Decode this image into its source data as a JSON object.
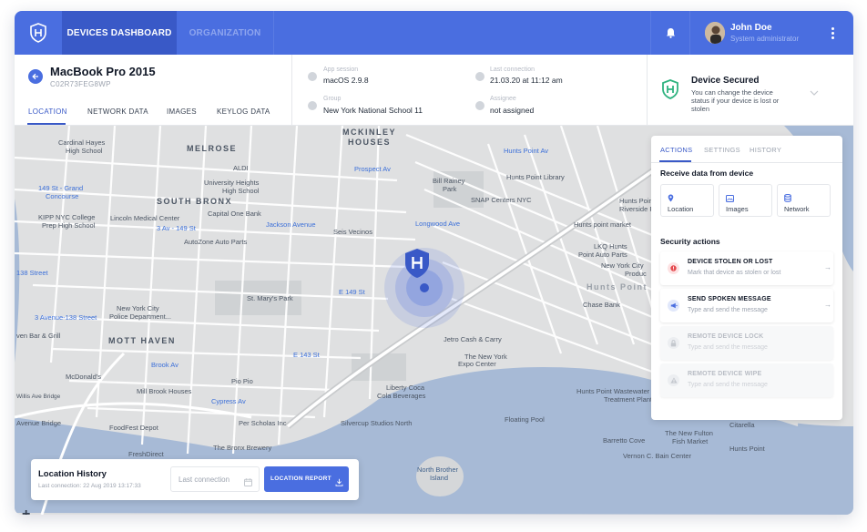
{
  "nav": {
    "logo_icon": "shield-h-logo-icon",
    "tabs": [
      {
        "label": "DEVICES DASHBOARD",
        "active": true
      },
      {
        "label": "ORGANIZATION",
        "active": false
      }
    ],
    "notification_icon": "bell-icon",
    "user": {
      "name": "John Doe",
      "role": "System administrator"
    },
    "menu_icon": "kebab-menu-icon"
  },
  "device": {
    "name": "MacBook Pro 2015",
    "id": "C02R73FEG8WP",
    "tabs": [
      "LOCATION",
      "NETWORK DATA",
      "IMAGES",
      "KEYLOG DATA"
    ],
    "active_tab": "LOCATION"
  },
  "info": {
    "app_session": {
      "label": "App session",
      "value": "macOS 2.9.8"
    },
    "last_connection": {
      "label": "Last connection",
      "value": "21.03.20 at 11:12 am"
    },
    "group": {
      "label": "Group",
      "value": "New York National School 11"
    },
    "assignee": {
      "label": "Assignee",
      "value": "not assigned"
    }
  },
  "status": {
    "title": "Device Secured",
    "description": "You can change the device status if your device is lost or stolen",
    "color": "#2fb380"
  },
  "panel": {
    "tabs": [
      "ACTIONS",
      "SETTINGS",
      "HISTORY"
    ],
    "receive_heading": "Receive data from device",
    "receive_items": [
      {
        "label": "Location",
        "icon": "location-pin-icon"
      },
      {
        "label": "Images",
        "icon": "image-icon"
      },
      {
        "label": "Network",
        "icon": "database-icon"
      }
    ],
    "security_heading": "Security actions",
    "actions": [
      {
        "title": "DEVICE STOLEN OR LOST",
        "desc": "Mark that device as stolen or lost",
        "enabled": true,
        "icon": "alert-icon",
        "color": "#e5484d"
      },
      {
        "title": "SEND SPOKEN MESSAGE",
        "desc": "Type and send the message",
        "enabled": true,
        "icon": "megaphone-icon",
        "color": "#4a6ee0"
      },
      {
        "title": "REMOTE DEVICE LOCK",
        "desc": "Type and send the message",
        "enabled": false,
        "icon": "lock-icon",
        "color": "#c4c8ce"
      },
      {
        "title": "REMOTE DEVICE WIPE",
        "desc": "Type and send the message",
        "enabled": false,
        "icon": "warning-icon",
        "color": "#c4c8ce"
      }
    ]
  },
  "history": {
    "title": "Location History",
    "subtitle": "Last connection: 22 Aug 2019 13:17:33",
    "date_placeholder": "Last connection",
    "report_button": "LOCATION REPORT"
  },
  "map": {
    "labels": {
      "melrose": "MELROSE",
      "mckinley": "MCKINLEY",
      "houses": "HOUSES",
      "south_bronx": "SOUTH BRONX",
      "mott_haven": "MOTT HAVEN",
      "hunts_point": "Hunts Point",
      "cardinal_hayes": "Cardinal Hayes",
      "high_school": "High School",
      "aldi": "ALDI",
      "university_heights": "University Heights",
      "university_hs": "High School",
      "capital_one": "Capital One Bank",
      "lincoln": "Lincoln Medical Center",
      "kipp": "KIPP NYC College",
      "prep_hs": "Prep High School",
      "grand_concourse": "149 St - Grand",
      "concourse": "Concourse",
      "third_ave": "3 Av - 149 St",
      "jackson_ave": "Jackson Avenue",
      "seis_vecinos": "Seis Vecinos",
      "longwood_ave": "Longwood Ave",
      "autozone": "AutoZone Auto Parts",
      "prospect_av": "Prospect Av",
      "hunts_point_av": "Hunts Point Av",
      "hunts_point_library": "Hunts Point Library",
      "bill_rainey": "Bill Rainey",
      "park": "Park",
      "snap_centers": "SNAP Centers NYC",
      "hunts_point_riverside": "Hunts Point",
      "riverside_park": "Riverside P",
      "hunts_point_market": "Hunts point market",
      "lkq": "LKQ Hunts",
      "point_auto": "Point Auto Parts",
      "ny_city": "New York City",
      "produce": "Produc",
      "st_marys": "St. Mary's Park",
      "e149": "E 149 St",
      "third_ave_138": "3 Avenue-138 Street",
      "nypd": "New York City",
      "police_dept": "Police Department...",
      "brook_av": "Brook Av",
      "e143": "E 143 St",
      "jetro": "Jetro Cash & Carry",
      "ny_expo": "The New York",
      "expo_center": "Expo Center",
      "chase_bank": "Chase Bank",
      "mcdonalds": "McDonald's",
      "pio_pio": "Pio Pio",
      "mill_brook": "Mill Brook Houses",
      "cypress_av": "Cypress Av",
      "liberty_coca": "Liberty Coca",
      "cola_bev": "Cola Beverages",
      "hunts_wastewater": "Hunts Point Wastewater",
      "treatment_plant": "Treatment Plant",
      "floating_pool": "Floating Pool",
      "food_depot": "FoodFest Depot",
      "per_scholas": "Per Scholas Inc",
      "silvercup": "Silvercup Studios North",
      "bronx_brewery": "The Bronx Brewery",
      "fresh_direct": "FreshDirect",
      "barretto": "Barretto Cove",
      "new_fulton": "The New Fulton",
      "fish_market": "Fish Market",
      "citarella": "Citarella",
      "vernon": "Vernon C. Bain Center",
      "hunts_point_bottom": "Hunts Point",
      "north_brother": "North Brother",
      "island": "Island",
      "avenue_bridge": "Avenue Bridge",
      "willis_bridge": "Willis Ave Bridge",
      "st138": "138 Street",
      "bar_grill": "ven Bar & Grill"
    }
  }
}
